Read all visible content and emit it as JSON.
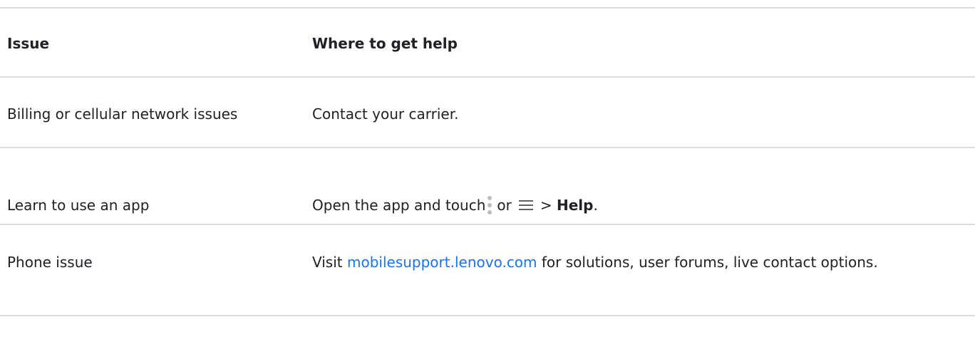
{
  "table": {
    "headers": {
      "issue": "Issue",
      "help": "Where to get help"
    },
    "rows": [
      {
        "issue": "Billing or cellular network issues",
        "help_text": "Contact your carrier."
      },
      {
        "issue": "Learn to use an app",
        "help_prefix": "Open the app and touch",
        "help_or": "or",
        "help_arrow": ">",
        "help_bold": "Help",
        "help_suffix": ".",
        "icons": [
          "more-vert-icon",
          "menu-icon"
        ]
      },
      {
        "issue": "Phone issue",
        "help_prefix": "Visit",
        "help_link": "mobilesupport.lenovo.com",
        "help_suffix": "for solutions, user forums, live contact options."
      }
    ]
  },
  "colors": {
    "text": "#202124",
    "link": "#1a73e8",
    "rule": "#dadce0"
  }
}
